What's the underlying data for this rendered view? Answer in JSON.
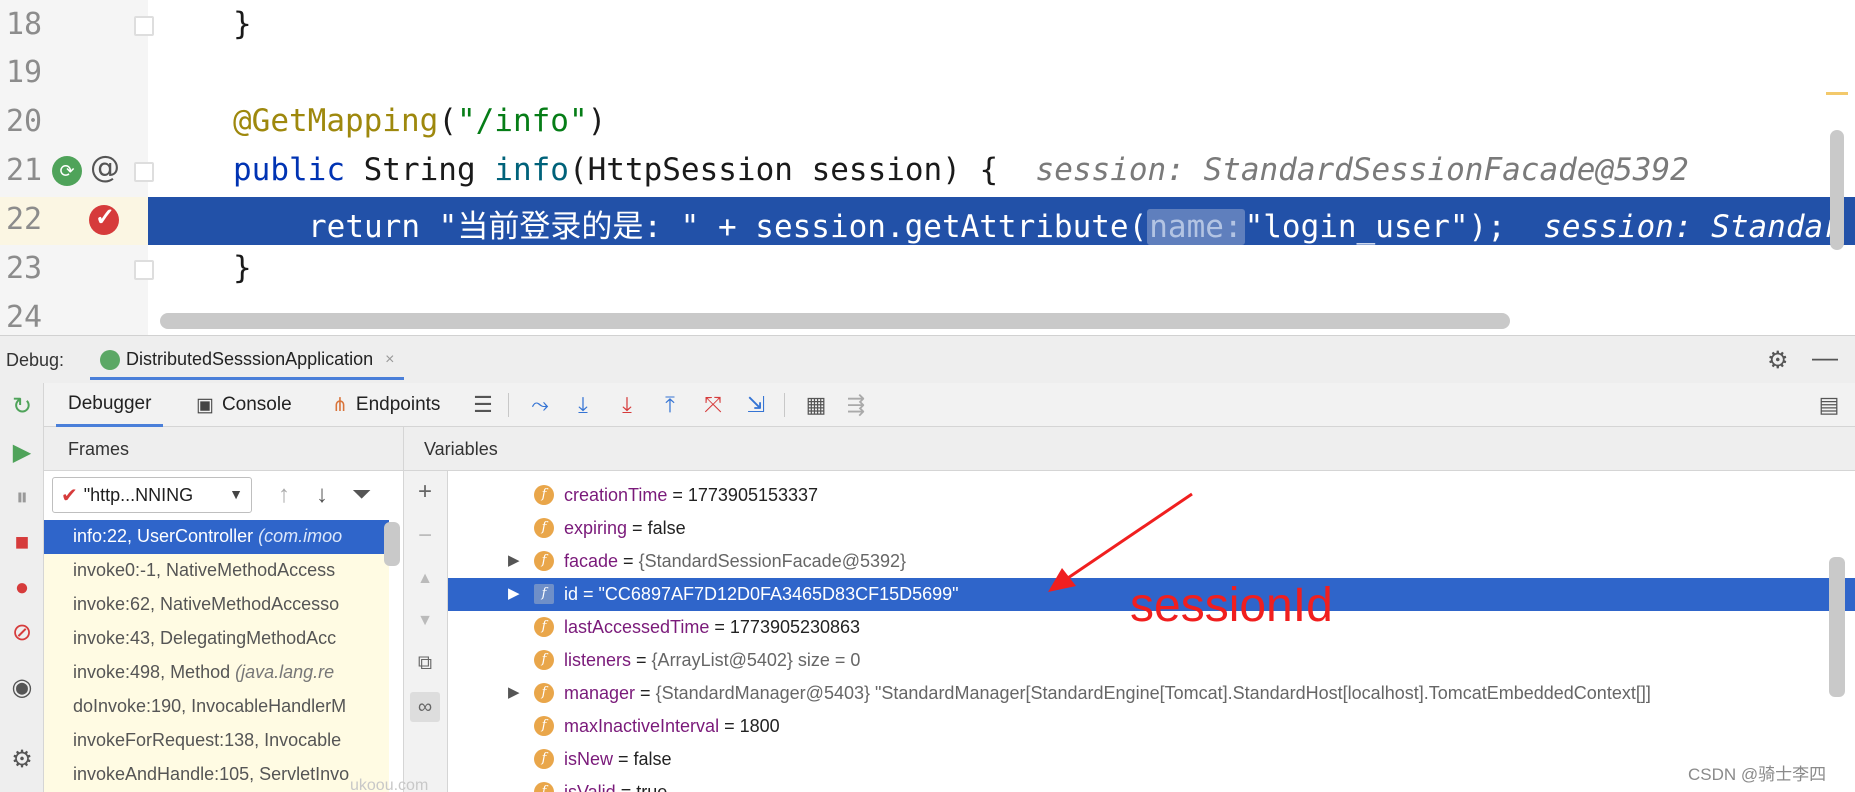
{
  "editor": {
    "lines": [
      {
        "num": "18",
        "code": "}"
      },
      {
        "num": "19",
        "code": ""
      },
      {
        "num": "20",
        "annotation": "@GetMapping",
        "paren_open": "(",
        "string": "\"/info\"",
        "paren_close": ")"
      },
      {
        "num": "21",
        "kw": "public",
        "type": " String ",
        "fn": "info",
        "rest": "(HttpSession session) {",
        "hint": "session: StandardSessionFacade@5392"
      },
      {
        "num": "22",
        "kw": "return",
        "str": "\"当前登录的是: \"",
        "mid": " + session.getAttribute(",
        "param_hint": "name:",
        "arg": "\"login_user\");",
        "hint": "session: Standar"
      },
      {
        "num": "23",
        "code": "}"
      },
      {
        "num": "24",
        "code": ""
      }
    ]
  },
  "debug": {
    "label": "Debug:",
    "config_tab": "DistributedSesssionApplication",
    "close_glyph": "×"
  },
  "toolbar": {
    "tabs": [
      "Debugger",
      "Console",
      "Endpoints"
    ]
  },
  "frames": {
    "header": "Frames",
    "thread": "\"http...NNING",
    "rows": [
      {
        "method": "info:22, UserController ",
        "pkg": "(com.imoo"
      },
      {
        "method": "invoke0:-1, NativeMethodAccess",
        "pkg": ""
      },
      {
        "method": "invoke:62, NativeMethodAccesso",
        "pkg": ""
      },
      {
        "method": "invoke:43, DelegatingMethodAcc",
        "pkg": ""
      },
      {
        "method": "invoke:498, Method ",
        "pkg": "(java.lang.re"
      },
      {
        "method": "doInvoke:190, InvocableHandlerM",
        "pkg": ""
      },
      {
        "method": "invokeForRequest:138, Invocable",
        "pkg": ""
      },
      {
        "method": "invokeAndHandle:105, ServletInvo",
        "pkg": ""
      }
    ]
  },
  "variables": {
    "header": "Variables",
    "rows": [
      {
        "name": "creationTime",
        "eq": " = ",
        "value": "1773905153337",
        "kind": "plain",
        "expand": ""
      },
      {
        "name": "expiring",
        "eq": " = ",
        "value": "false",
        "kind": "plain",
        "expand": ""
      },
      {
        "name": "facade",
        "eq": " = ",
        "value": "{StandardSessionFacade@5392}",
        "kind": "ref",
        "expand": "▶"
      },
      {
        "name": "id",
        "eq": " = ",
        "value": "\"CC6897AF7D12D0FA3465D83CF15D5699\"",
        "kind": "str",
        "expand": "▶"
      },
      {
        "name": "lastAccessedTime",
        "eq": " = ",
        "value": "1773905230863",
        "kind": "plain",
        "expand": ""
      },
      {
        "name": "listeners",
        "eq": " = ",
        "value": "{ArrayList@5402}  size = 0",
        "kind": "ref",
        "expand": ""
      },
      {
        "name": "manager",
        "eq": " = ",
        "value": "{StandardManager@5403} \"StandardManager[StandardEngine[Tomcat].StandardHost[localhost].TomcatEmbeddedContext[]]",
        "kind": "ref",
        "expand": "▶"
      },
      {
        "name": "maxInactiveInterval",
        "eq": " = ",
        "value": "1800",
        "kind": "plain",
        "expand": ""
      },
      {
        "name": "isNew",
        "eq": " = ",
        "value": "false",
        "kind": "plain",
        "expand": ""
      },
      {
        "name": "isValid",
        "eq": " = ",
        "value": "true",
        "kind": "plain",
        "expand": ""
      }
    ]
  },
  "annotation": {
    "text": "sessionId",
    "color": "#f01f1f"
  },
  "watermark": "CSDN @骑士李四",
  "bottom_watermark": "ukoou.com"
}
